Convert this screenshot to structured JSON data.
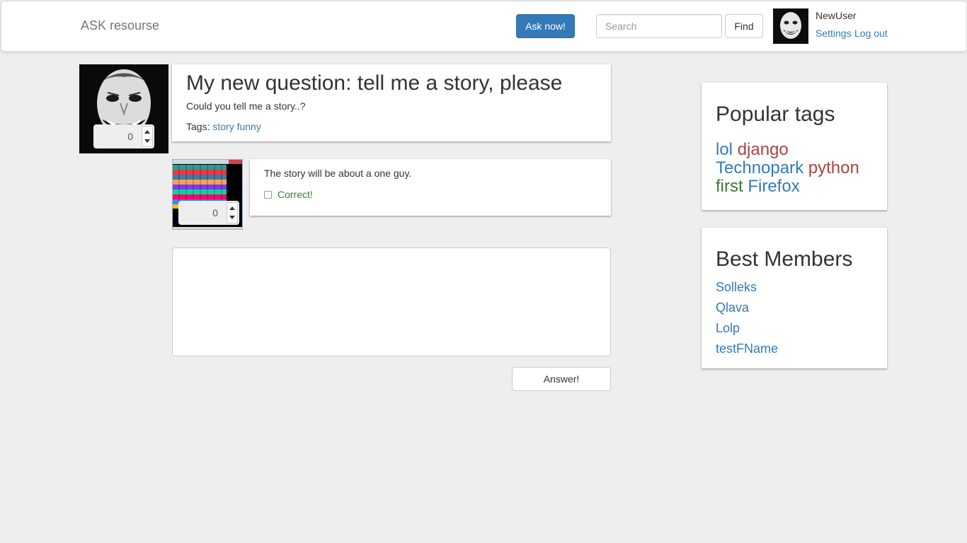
{
  "navbar": {
    "brand": "ASK resourse",
    "ask_label": "Ask now!",
    "search_placeholder": "Search",
    "find_label": "Find",
    "username": "NewUser",
    "settings_label": "Settings",
    "logout_label": "Log out"
  },
  "question": {
    "title": "My new question: tell me a story, please",
    "text": "Could you tell me a story..?",
    "tags_label": "Tags:",
    "tags": [
      "story",
      "funny"
    ],
    "rating": "0"
  },
  "answer": {
    "text": "The story will be about a one guy.",
    "correct_label": "Correct!",
    "correct_checked": false,
    "rating": "0"
  },
  "answer_form": {
    "text_value": "",
    "submit_label": "Answer!"
  },
  "sidebar": {
    "popular_tags": {
      "title": "Popular tags",
      "tags": [
        {
          "label": "lol",
          "color": "#337ab7"
        },
        {
          "label": "django",
          "color": "#a94442"
        },
        {
          "label": "Technopark",
          "color": "#337ab7"
        },
        {
          "label": "python",
          "color": "#a94442"
        },
        {
          "label": "first",
          "color": "#3c763d"
        },
        {
          "label": "Firefox",
          "color": "#337ab7"
        }
      ]
    },
    "best_members": {
      "title": "Best Members",
      "members": [
        "Solleks",
        "Qlava",
        "Lolp",
        "testFName"
      ]
    }
  },
  "colors": {
    "primary": "#337ab7",
    "background": "#eeeeee",
    "success": "#3c763d",
    "danger": "#a94442"
  }
}
